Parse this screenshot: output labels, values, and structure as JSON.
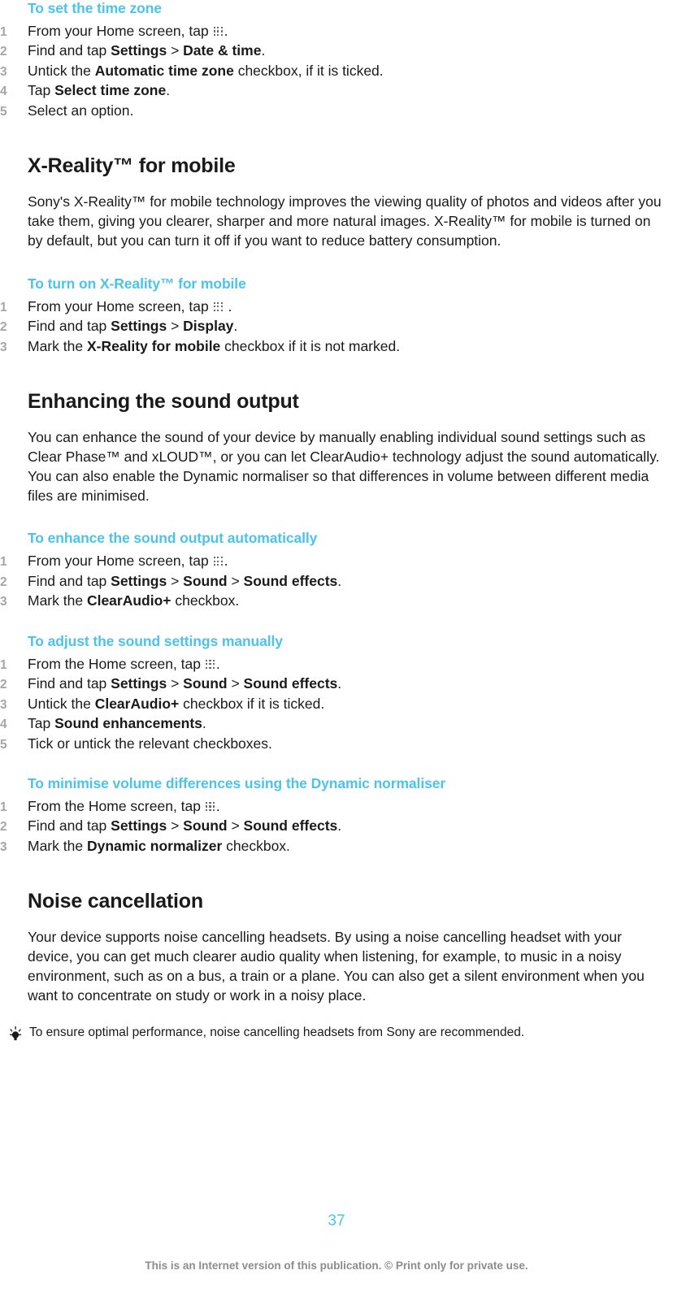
{
  "page": {
    "number": "37",
    "footer_note": "This is an Internet version of this publication. © Print only for private use.",
    "accent_color": "#4cc3e8",
    "text_color": "#1a1a1a",
    "number_marker_color": "#a6a6a6",
    "footer_color": "#8c8c8c"
  },
  "icons": {
    "app_drawer": "grid-dots-icon",
    "tip": "lightbulb-icon"
  },
  "sections": {
    "time_zone_proc": {
      "title": "To set the time zone",
      "steps": [
        {
          "num": "1",
          "html": "From your Home screen, tap <span class=\"grid-icon\" data-name=\"app-drawer-icon\" data-interactable=\"false\"><i style=\"left:0;top:0\"></i><i style=\"left:4.5px;top:0\"></i><i style=\"left:9px;top:0\"></i><i style=\"left:0;top:4.5px\"></i><i style=\"left:4.5px;top:4.5px\"></i><i style=\"left:9px;top:4.5px\"></i><i style=\"left:0;top:9px\"></i><i style=\"left:4.5px;top:9px\"></i><i style=\"left:9px;top:9px\"></i></span>."
        },
        {
          "num": "2",
          "html": "Find and tap <b>Settings</b> &gt; <b>Date &amp; time</b>."
        },
        {
          "num": "3",
          "html": "Untick the <b>Automatic time zone</b> checkbox, if it is ticked."
        },
        {
          "num": "4",
          "html": "Tap <b>Select time zone</b>."
        },
        {
          "num": "5",
          "html": "Select an option."
        }
      ]
    },
    "xreality": {
      "heading": "X-Reality™ for mobile",
      "body": "Sony's X-Reality™ for mobile technology improves the viewing quality of photos and videos after you take them, giving you clearer, sharper and more natural images. X-Reality™ for mobile is turned on by default, but you can turn it off if you want to reduce battery consumption.",
      "proc": {
        "title": "To turn on X-Reality™ for mobile",
        "steps": [
          {
            "num": "1",
            "html": "From your Home screen, tap <span class=\"grid-icon\" data-name=\"app-drawer-icon\" data-interactable=\"false\"><i style=\"left:0;top:0\"></i><i style=\"left:4.5px;top:0\"></i><i style=\"left:9px;top:0\"></i><i style=\"left:0;top:4.5px\"></i><i style=\"left:4.5px;top:4.5px\"></i><i style=\"left:9px;top:4.5px\"></i><i style=\"left:0;top:9px\"></i><i style=\"left:4.5px;top:9px\"></i><i style=\"left:9px;top:9px\"></i></span> ."
          },
          {
            "num": "2",
            "html": "Find and tap <b>Settings</b> &gt; <b>Display</b>."
          },
          {
            "num": "3",
            "html": "Mark the <b>X-Reality for mobile</b> checkbox if it is not marked."
          }
        ]
      }
    },
    "sound_output": {
      "heading": "Enhancing the sound output",
      "body": "You can enhance the sound of your device by manually enabling individual sound settings such as Clear Phase™ and xLOUD™, or you can let ClearAudio+ technology adjust the sound automatically. You can also enable the Dynamic normaliser so that differences in volume between different media files are minimised.",
      "proc_auto": {
        "title": "To enhance the sound output automatically",
        "steps": [
          {
            "num": "1",
            "html": "From your Home screen, tap <span class=\"grid-icon\" data-name=\"app-drawer-icon\" data-interactable=\"false\"><i style=\"left:0;top:0\"></i><i style=\"left:4.5px;top:0\"></i><i style=\"left:9px;top:0\"></i><i style=\"left:0;top:4.5px\"></i><i style=\"left:4.5px;top:4.5px\"></i><i style=\"left:9px;top:4.5px\"></i><i style=\"left:0;top:9px\"></i><i style=\"left:4.5px;top:9px\"></i><i style=\"left:9px;top:9px\"></i></span>."
          },
          {
            "num": "2",
            "html": "Find and tap <b>Settings</b> &gt; <b>Sound</b> &gt; <b>Sound effects</b>."
          },
          {
            "num": "3",
            "html": "Mark the <b>ClearAudio+</b> checkbox."
          }
        ]
      },
      "proc_manual": {
        "title": "To adjust the sound settings manually",
        "steps": [
          {
            "num": "1",
            "html": "From the Home screen, tap <span class=\"grid-icon\" data-name=\"app-drawer-icon\" data-interactable=\"false\"><i style=\"left:0;top:0\"></i><i style=\"left:4.5px;top:0\"></i><i style=\"left:9px;top:0\"></i><i style=\"left:0;top:4.5px\"></i><i style=\"left:4.5px;top:4.5px\"></i><i style=\"left:9px;top:4.5px\"></i><i style=\"left:0;top:9px\"></i><i style=\"left:4.5px;top:9px\"></i><i style=\"left:9px;top:9px\"></i></span>."
          },
          {
            "num": "2",
            "html": "Find and tap <b>Settings</b> &gt; <b>Sound</b> &gt; <b>Sound effects</b>."
          },
          {
            "num": "3",
            "html": "Untick the <b>ClearAudio+</b> checkbox if it is ticked."
          },
          {
            "num": "4",
            "html": "Tap <b>Sound enhancements</b>."
          },
          {
            "num": "5",
            "html": "Tick or untick the relevant checkboxes."
          }
        ]
      },
      "proc_normaliser": {
        "title": "To minimise volume differences using the Dynamic normaliser",
        "steps": [
          {
            "num": "1",
            "html": "From the Home screen, tap <span class=\"grid-icon\" data-name=\"app-drawer-icon\" data-interactable=\"false\"><i style=\"left:0;top:0\"></i><i style=\"left:4.5px;top:0\"></i><i style=\"left:9px;top:0\"></i><i style=\"left:0;top:4.5px\"></i><i style=\"left:4.5px;top:4.5px\"></i><i style=\"left:9px;top:4.5px\"></i><i style=\"left:0;top:9px\"></i><i style=\"left:4.5px;top:9px\"></i><i style=\"left:9px;top:9px\"></i></span>."
          },
          {
            "num": "2",
            "html": "Find and tap <b>Settings</b> &gt; <b>Sound</b> &gt; <b>Sound effects</b>."
          },
          {
            "num": "3",
            "html": "Mark the <b>Dynamic normalizer</b> checkbox."
          }
        ]
      }
    },
    "noise_cancellation": {
      "heading": "Noise cancellation",
      "body": "Your device supports noise cancelling headsets. By using a noise cancelling headset with your device, you can get much clearer audio quality when listening, for example, to music in a noisy environment, such as on a bus, a train or a plane. You can also get a silent environment when you want to concentrate on study or work in a noisy place.",
      "tip": "To ensure optimal performance, noise cancelling headsets from Sony are recommended."
    }
  }
}
